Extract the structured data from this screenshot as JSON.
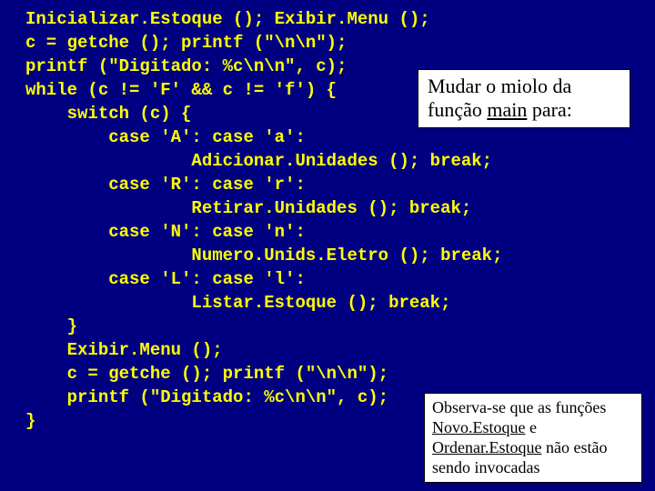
{
  "code": {
    "l1": "Inicializar.Estoque (); Exibir.Menu ();",
    "l2": "c = getche (); printf (\"\\n\\n\");",
    "l3": "printf (\"Digitado: %c\\n\\n\", c);",
    "l4": "while (c != 'F' && c != 'f') {",
    "l5": "    switch (c) {",
    "l6": "        case 'A': case 'a':",
    "l7": "                Adicionar.Unidades (); break;",
    "l8": "        case 'R': case 'r':",
    "l9": "                Retirar.Unidades (); break;",
    "l10": "        case 'N': case 'n':",
    "l11": "                Numero.Unids.Eletro (); break;",
    "l12": "        case 'L': case 'l':",
    "l13": "                Listar.Estoque (); break;",
    "l14": "    }",
    "l15": "    Exibir.Menu ();",
    "l16": "    c = getche (); printf (\"\\n\\n\");",
    "l17": "    printf (\"Digitado: %c\\n\\n\", c);",
    "l18": "}"
  },
  "callout1": {
    "part1": "Mudar o miolo da função ",
    "main": "main",
    "part2": " para:"
  },
  "callout2": {
    "line1": "Observa-se que as funções ",
    "fn1": "Novo.Estoque",
    "mid1": " e ",
    "fn2": "Ordenar.Estoque",
    "line2": " não estão sendo invocadas"
  }
}
